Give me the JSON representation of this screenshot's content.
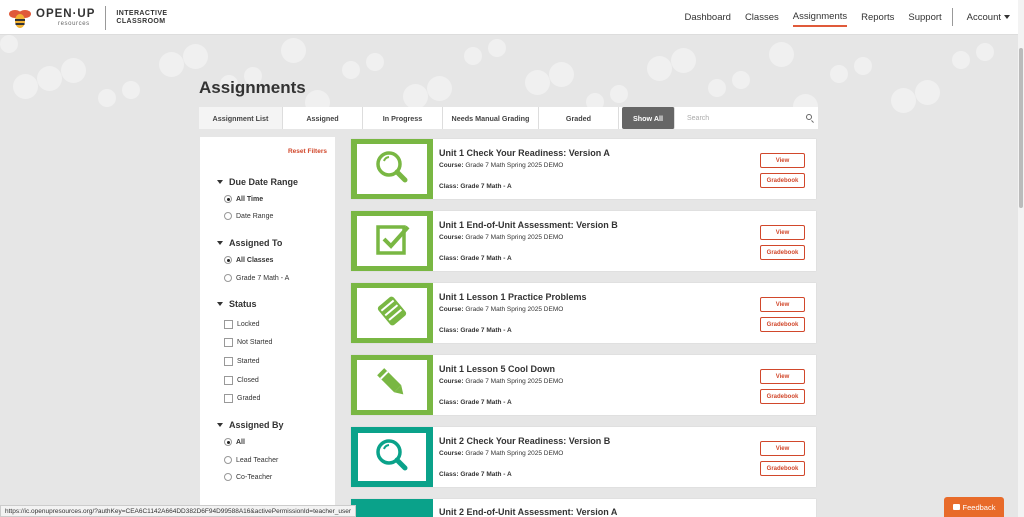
{
  "header": {
    "logo_main": "OPEN·UP",
    "logo_sub": "resources",
    "logo_product": [
      "INTERACTIVE",
      "CLASSROOM"
    ],
    "nav": [
      {
        "label": "Dashboard"
      },
      {
        "label": "Classes"
      },
      {
        "label": "Assignments",
        "active": true
      },
      {
        "label": "Reports"
      },
      {
        "label": "Support"
      }
    ],
    "account_label": "Account"
  },
  "page": {
    "title": "Assignments"
  },
  "tabs": {
    "items": [
      "Assignment List",
      "Assigned",
      "In Progress",
      "Needs Manual Grading",
      "Graded"
    ],
    "show_all": "Show All",
    "search_placeholder": "Search"
  },
  "filters": {
    "reset": "Reset Filters",
    "due_date": {
      "title": "Due Date Range",
      "options": [
        "All Time",
        "Date Range"
      ],
      "selected": 0
    },
    "assigned_to": {
      "title": "Assigned To",
      "options": [
        "All Classes",
        "Grade 7 Math - A"
      ],
      "selected": 0
    },
    "status": {
      "title": "Status",
      "options": [
        "Locked",
        "Not Started",
        "Started",
        "Closed",
        "Graded"
      ]
    },
    "assigned_by": {
      "title": "Assigned By",
      "options": [
        "All",
        "Lead Teacher",
        "Co-Teacher"
      ],
      "selected": 0
    }
  },
  "labels": {
    "course": "Course:",
    "class": "Class:",
    "view": "View",
    "gradebook": "Gradebook"
  },
  "assignments": [
    {
      "title": "Unit 1 Check Your Readiness: Version A",
      "course": "Grade 7 Math Spring 2025 DEMO",
      "class": "Grade 7 Math - A",
      "icon": "magnifier-icon",
      "color": "#79b743"
    },
    {
      "title": "Unit 1 End-of-Unit Assessment: Version B",
      "course": "Grade 7 Math Spring 2025 DEMO",
      "class": "Grade 7 Math - A",
      "icon": "checkbox-icon",
      "color": "#79b743"
    },
    {
      "title": "Unit 1 Lesson 1 Practice Problems",
      "course": "Grade 7 Math Spring 2025 DEMO",
      "class": "Grade 7 Math - A",
      "icon": "hands-icon",
      "color": "#79b743"
    },
    {
      "title": "Unit 1 Lesson 5 Cool Down",
      "course": "Grade 7 Math Spring 2025 DEMO",
      "class": "Grade 7 Math - A",
      "icon": "pencil-icon",
      "color": "#79b743"
    },
    {
      "title": "Unit 2 Check Your Readiness: Version B",
      "course": "Grade 7 Math Spring 2025 DEMO",
      "class": "Grade 7 Math - A",
      "icon": "magnifier-icon",
      "color": "#0aa28a"
    },
    {
      "title": "Unit 2 End-of-Unit Assessment: Version A",
      "course": "",
      "class": "",
      "icon": "checkbox-icon",
      "color": "#0aa28a"
    }
  ],
  "status_url": "https://ic.openupresources.org/?authKey=CEA6C1142A664DD382D6F94D99588A16&activePermissionId=teacher_user",
  "feedback": "Feedback"
}
